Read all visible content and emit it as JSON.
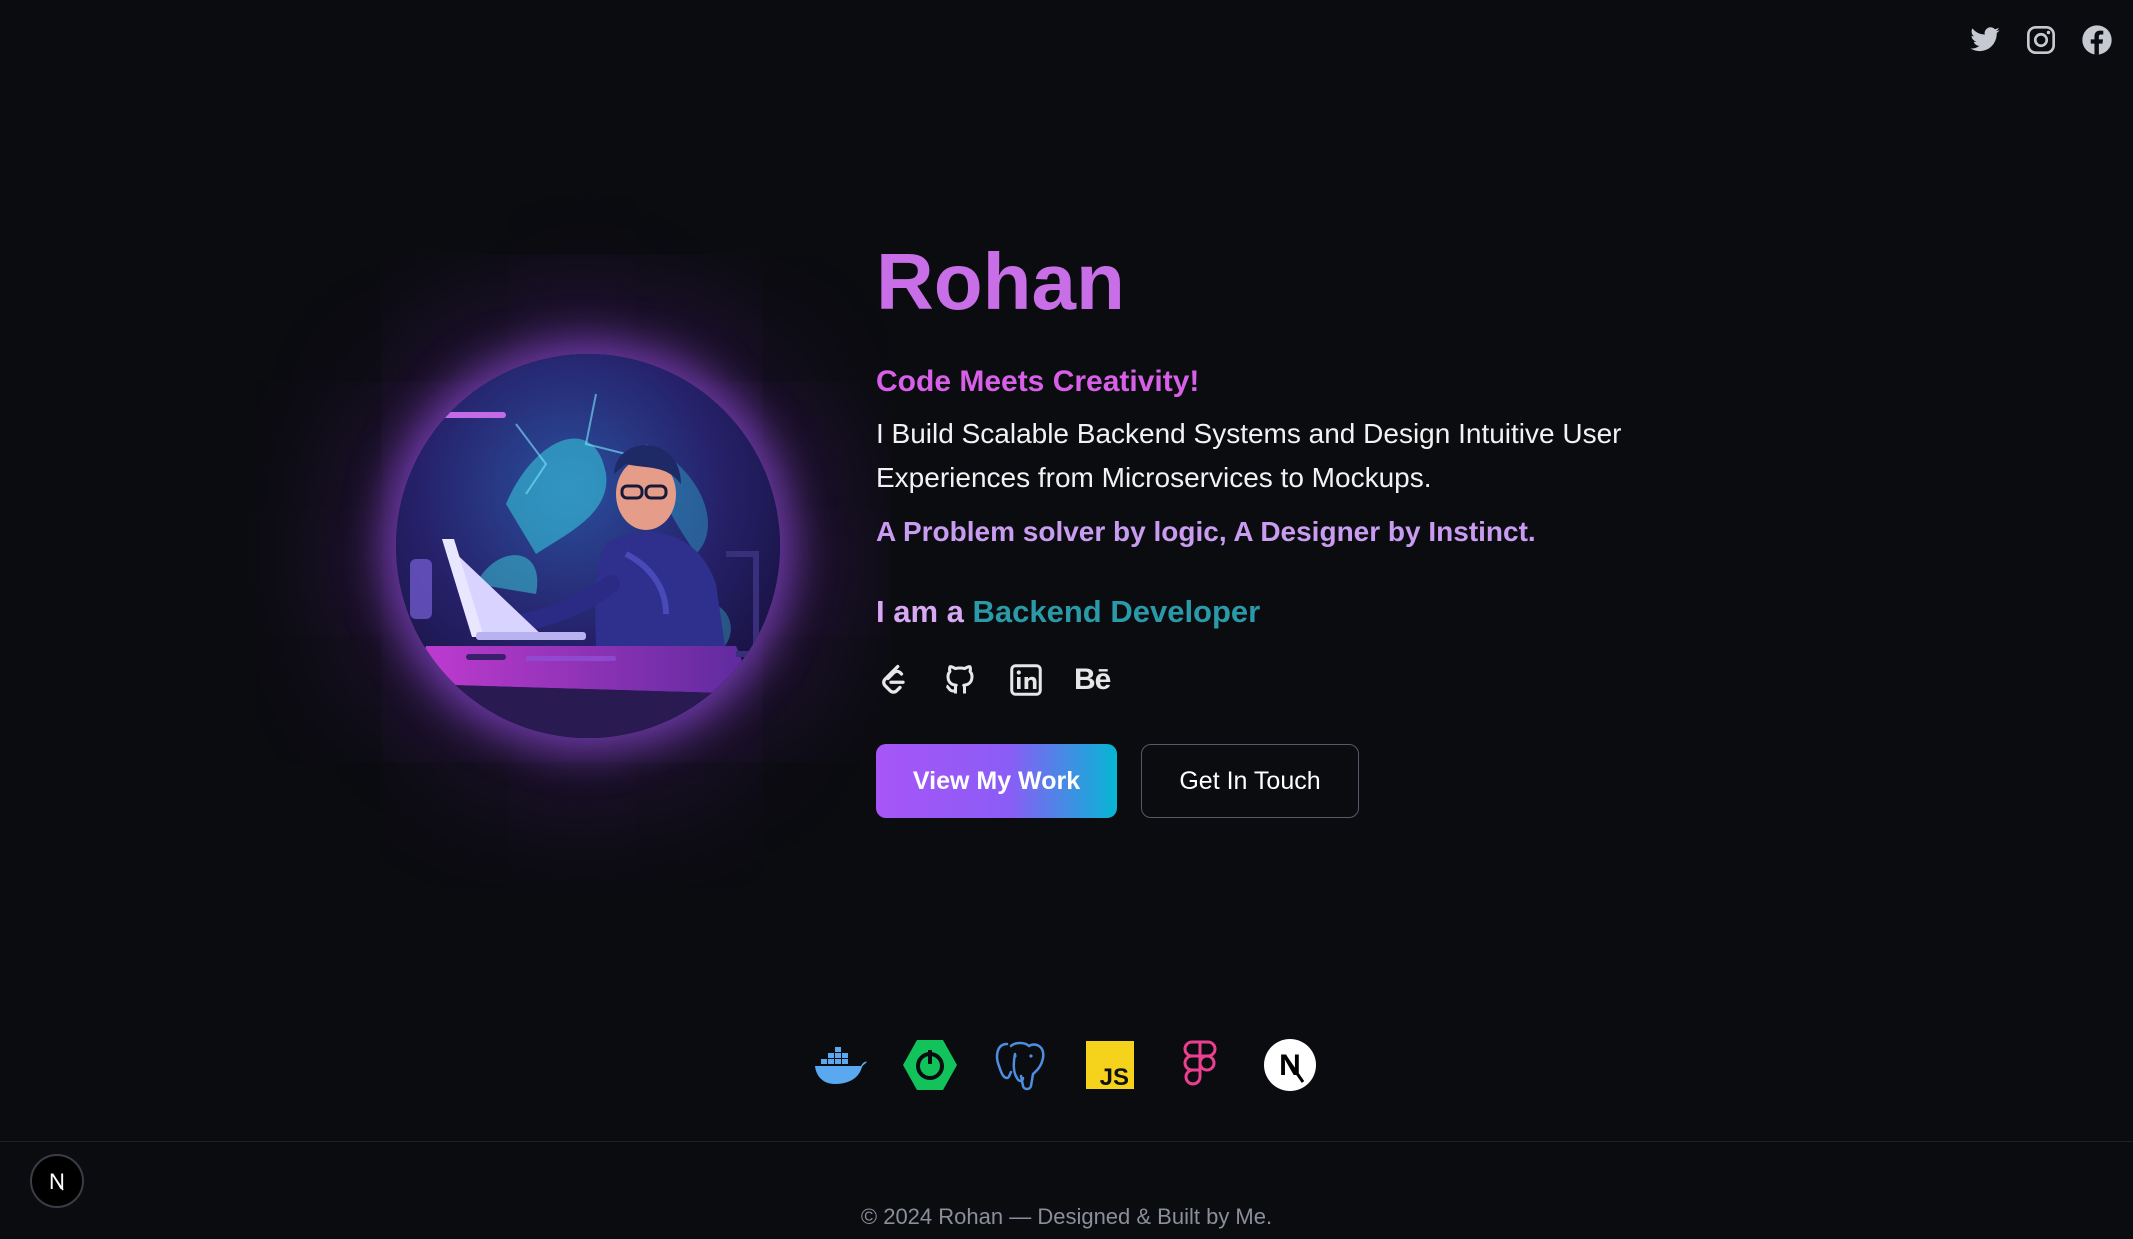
{
  "social_top": [
    {
      "name": "twitter",
      "icon": "twitter-icon"
    },
    {
      "name": "instagram",
      "icon": "instagram-icon"
    },
    {
      "name": "facebook",
      "icon": "facebook-icon"
    }
  ],
  "hero": {
    "name": "Rohan",
    "tagline": "Code Meets Creativity!",
    "description": "I Build Scalable Backend Systems and Design Intuitive User Experiences from Microservices to Mockups.",
    "motto": "A Problem solver by logic, A Designer by Instinct.",
    "role_prefix": "I am a ",
    "role_value": "Backend Developer"
  },
  "profile_links": [
    {
      "name": "leetcode",
      "icon": "leetcode-icon"
    },
    {
      "name": "github",
      "icon": "github-icon"
    },
    {
      "name": "linkedin",
      "icon": "linkedin-icon"
    },
    {
      "name": "behance",
      "icon": "behance-icon",
      "text": "Bē"
    }
  ],
  "buttons": {
    "primary": "View My Work",
    "secondary": "Get In Touch"
  },
  "tech_stack": [
    {
      "name": "docker",
      "icon": "docker-icon"
    },
    {
      "name": "spring",
      "icon": "spring-boot-icon"
    },
    {
      "name": "postgresql",
      "icon": "postgresql-icon"
    },
    {
      "name": "javascript",
      "icon": "javascript-icon",
      "text": "JS"
    },
    {
      "name": "figma",
      "icon": "figma-icon"
    },
    {
      "name": "nextjs",
      "icon": "nextjs-icon",
      "text": "N"
    }
  ],
  "footer": {
    "copyright": "© 2024 Rohan — Designed & Built by Me.",
    "badge_letter": "N"
  },
  "colors": {
    "background": "#0b0c10",
    "name": "#c86ee6",
    "tagline": "#d85fe8",
    "motto": "#c99cf2",
    "role_value": "#2b9aa8",
    "button_gradient_start": "#a855f7",
    "button_gradient_end": "#06b6d4"
  }
}
